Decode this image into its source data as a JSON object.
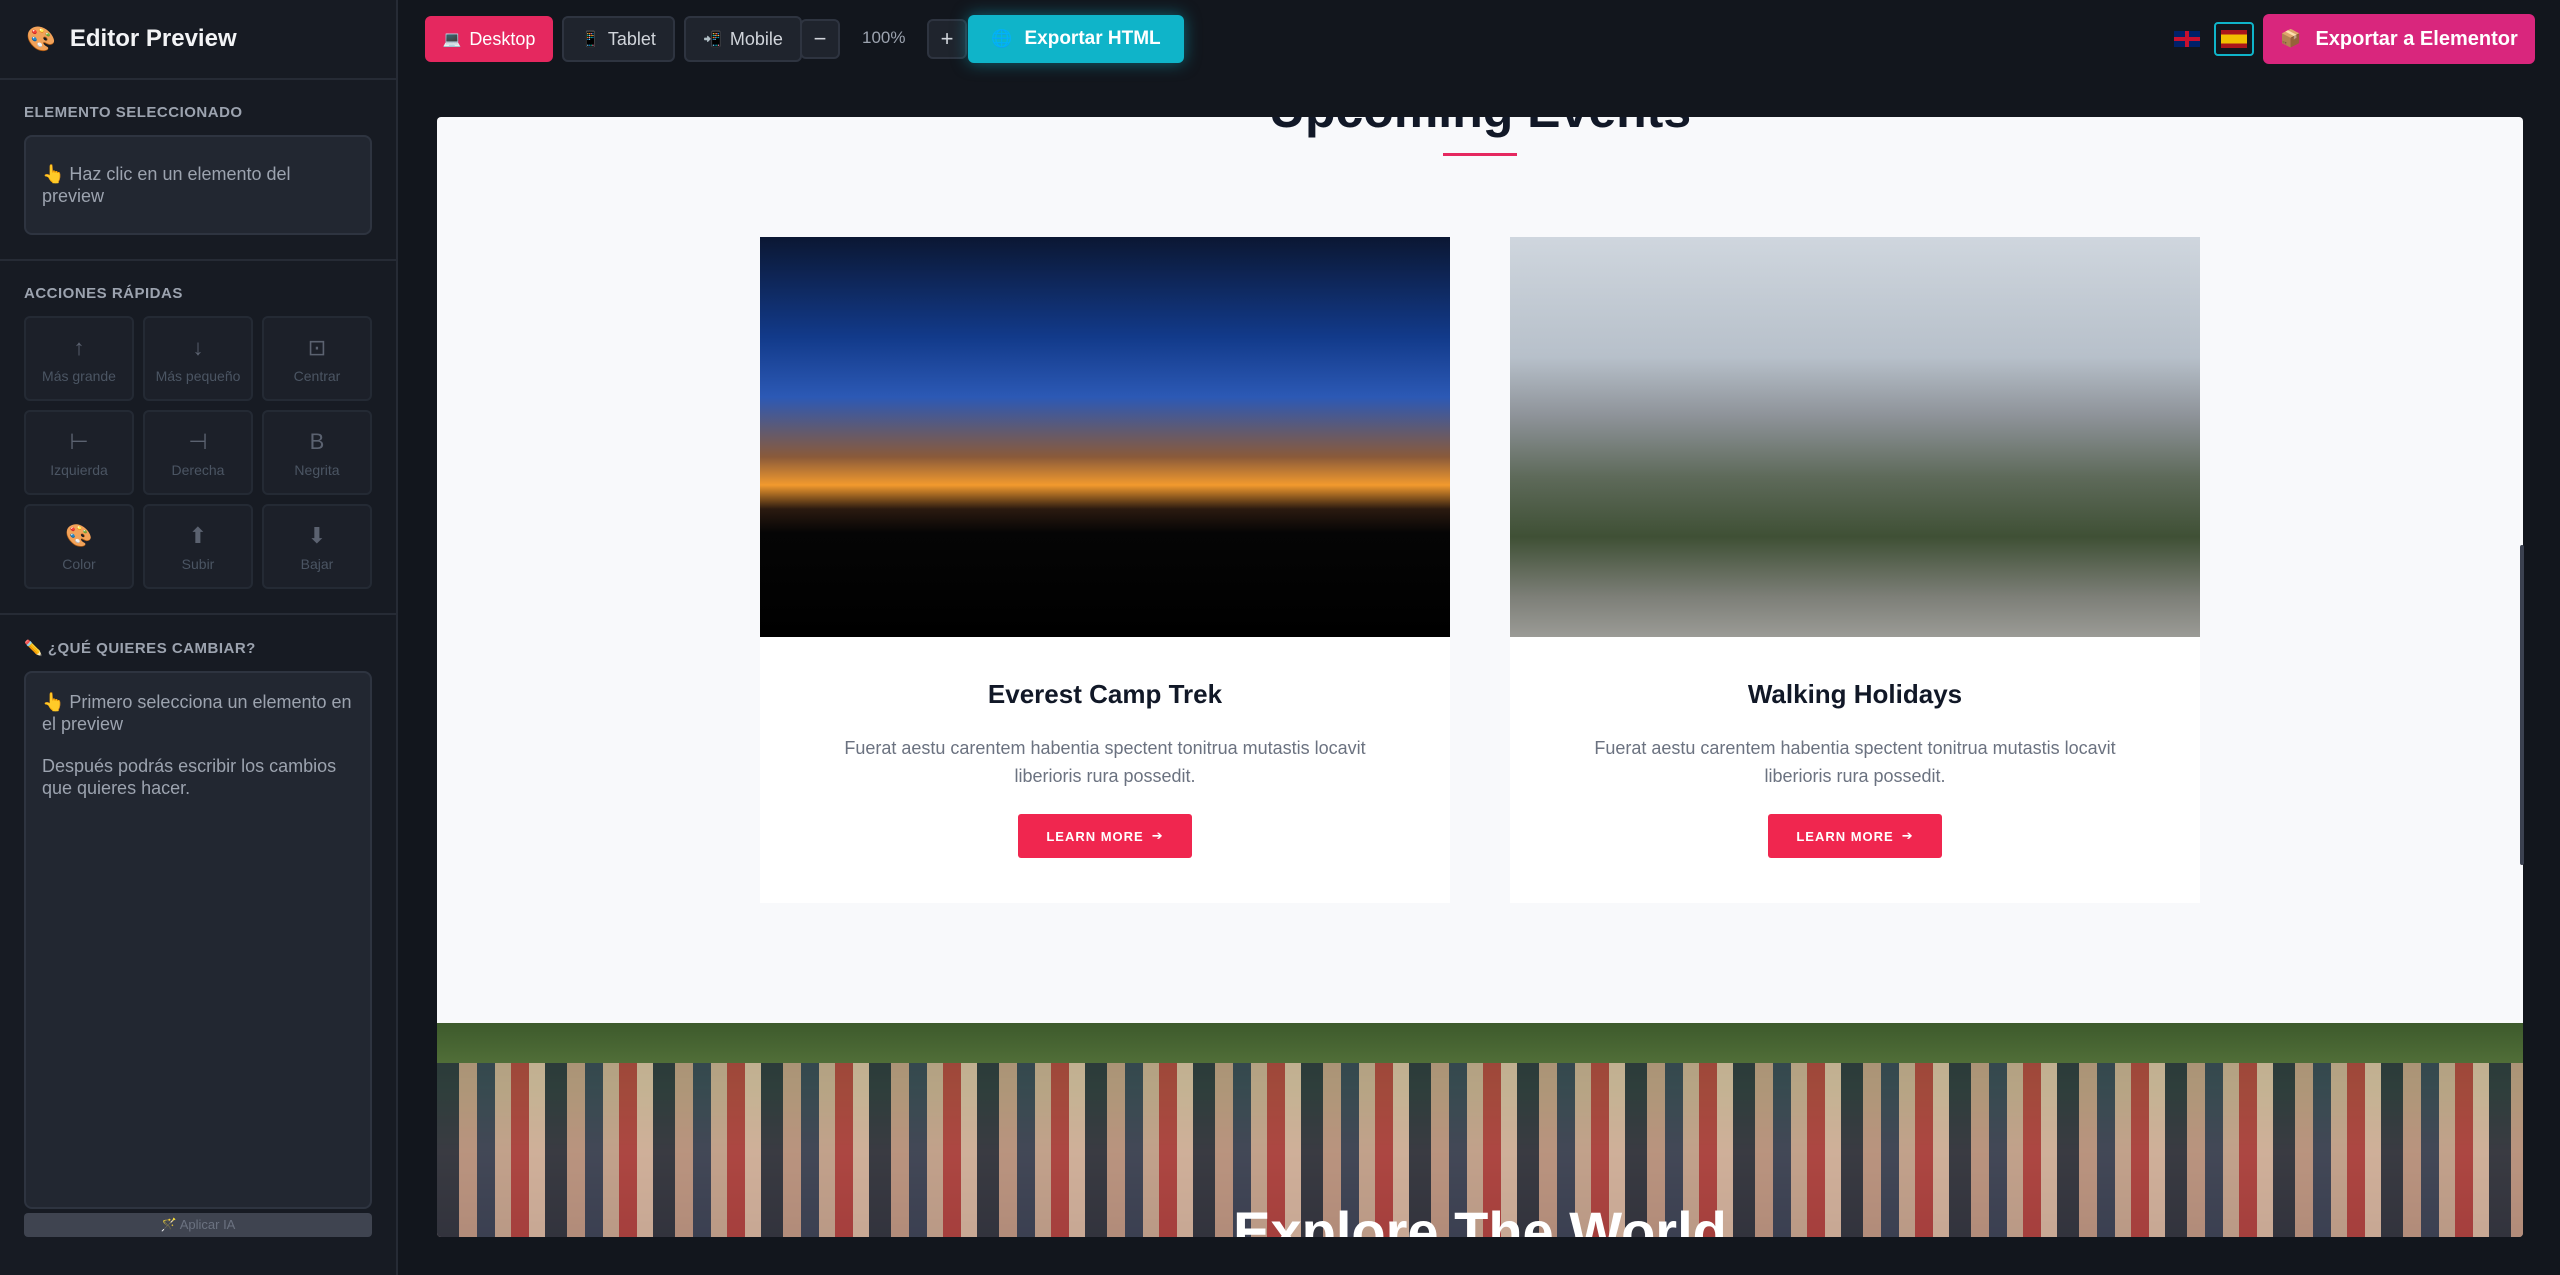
{
  "sidebar": {
    "logo_icon": "palette-icon",
    "title": "Editor Preview",
    "selected_label": "ELEMENTO SELECCIONADO",
    "selected_hint": "👆 Haz clic en un elemento del preview",
    "quick_label": "ACCIONES RÁPIDAS",
    "quick_actions": [
      {
        "icon": "↑",
        "label": "Más grande"
      },
      {
        "icon": "↓",
        "label": "Más pequeño"
      },
      {
        "icon": "⊡",
        "label": "Centrar"
      },
      {
        "icon": "⊢",
        "label": "Izquierda"
      },
      {
        "icon": "⊣",
        "label": "Derecha"
      },
      {
        "icon": "B",
        "label": "Negrita"
      },
      {
        "icon": "🎨",
        "label": "Color"
      },
      {
        "icon": "⬆",
        "label": "Subir"
      },
      {
        "icon": "⬇",
        "label": "Bajar"
      }
    ],
    "change_label": "✏️ ¿QUÉ QUIERES CAMBIAR?",
    "change_hint_1": "👆 Primero selecciona un elemento en el preview",
    "change_hint_2": "Después podrás escribir los cambios que quieres hacer.",
    "apply_label": "🪄 Aplicar IA"
  },
  "topbar": {
    "devices": [
      {
        "icon": "💻",
        "label": "Desktop",
        "active": true
      },
      {
        "icon": "📱",
        "label": "Tablet",
        "active": false
      },
      {
        "icon": "📲",
        "label": "Mobile",
        "active": false
      }
    ],
    "zoom_out": "−",
    "zoom_value": "100%",
    "zoom_in": "+",
    "export_html_icon": "🌐",
    "export_html": "Exportar HTML",
    "export_elementor_icon": "📦",
    "export_elementor": "Exportar a Elementor"
  },
  "preview": {
    "section_title": "Upcoming Events",
    "cards": [
      {
        "title": "Everest Camp Trek",
        "text": "Fuerat aestu carentem habentia spectent tonitrua mutastis locavit liberioris rura possedit.",
        "button": "LEARN MORE"
      },
      {
        "title": "Walking Holidays",
        "text": "Fuerat aestu carentem habentia spectent tonitrua mutastis locavit liberioris rura possedit.",
        "button": "LEARN MORE"
      }
    ],
    "banner_title": "Explore The World"
  },
  "colors": {
    "accent": "#e5285f",
    "cyan": "#0fb4c9",
    "elementor": "#d9267d",
    "bg": "#12161d"
  }
}
